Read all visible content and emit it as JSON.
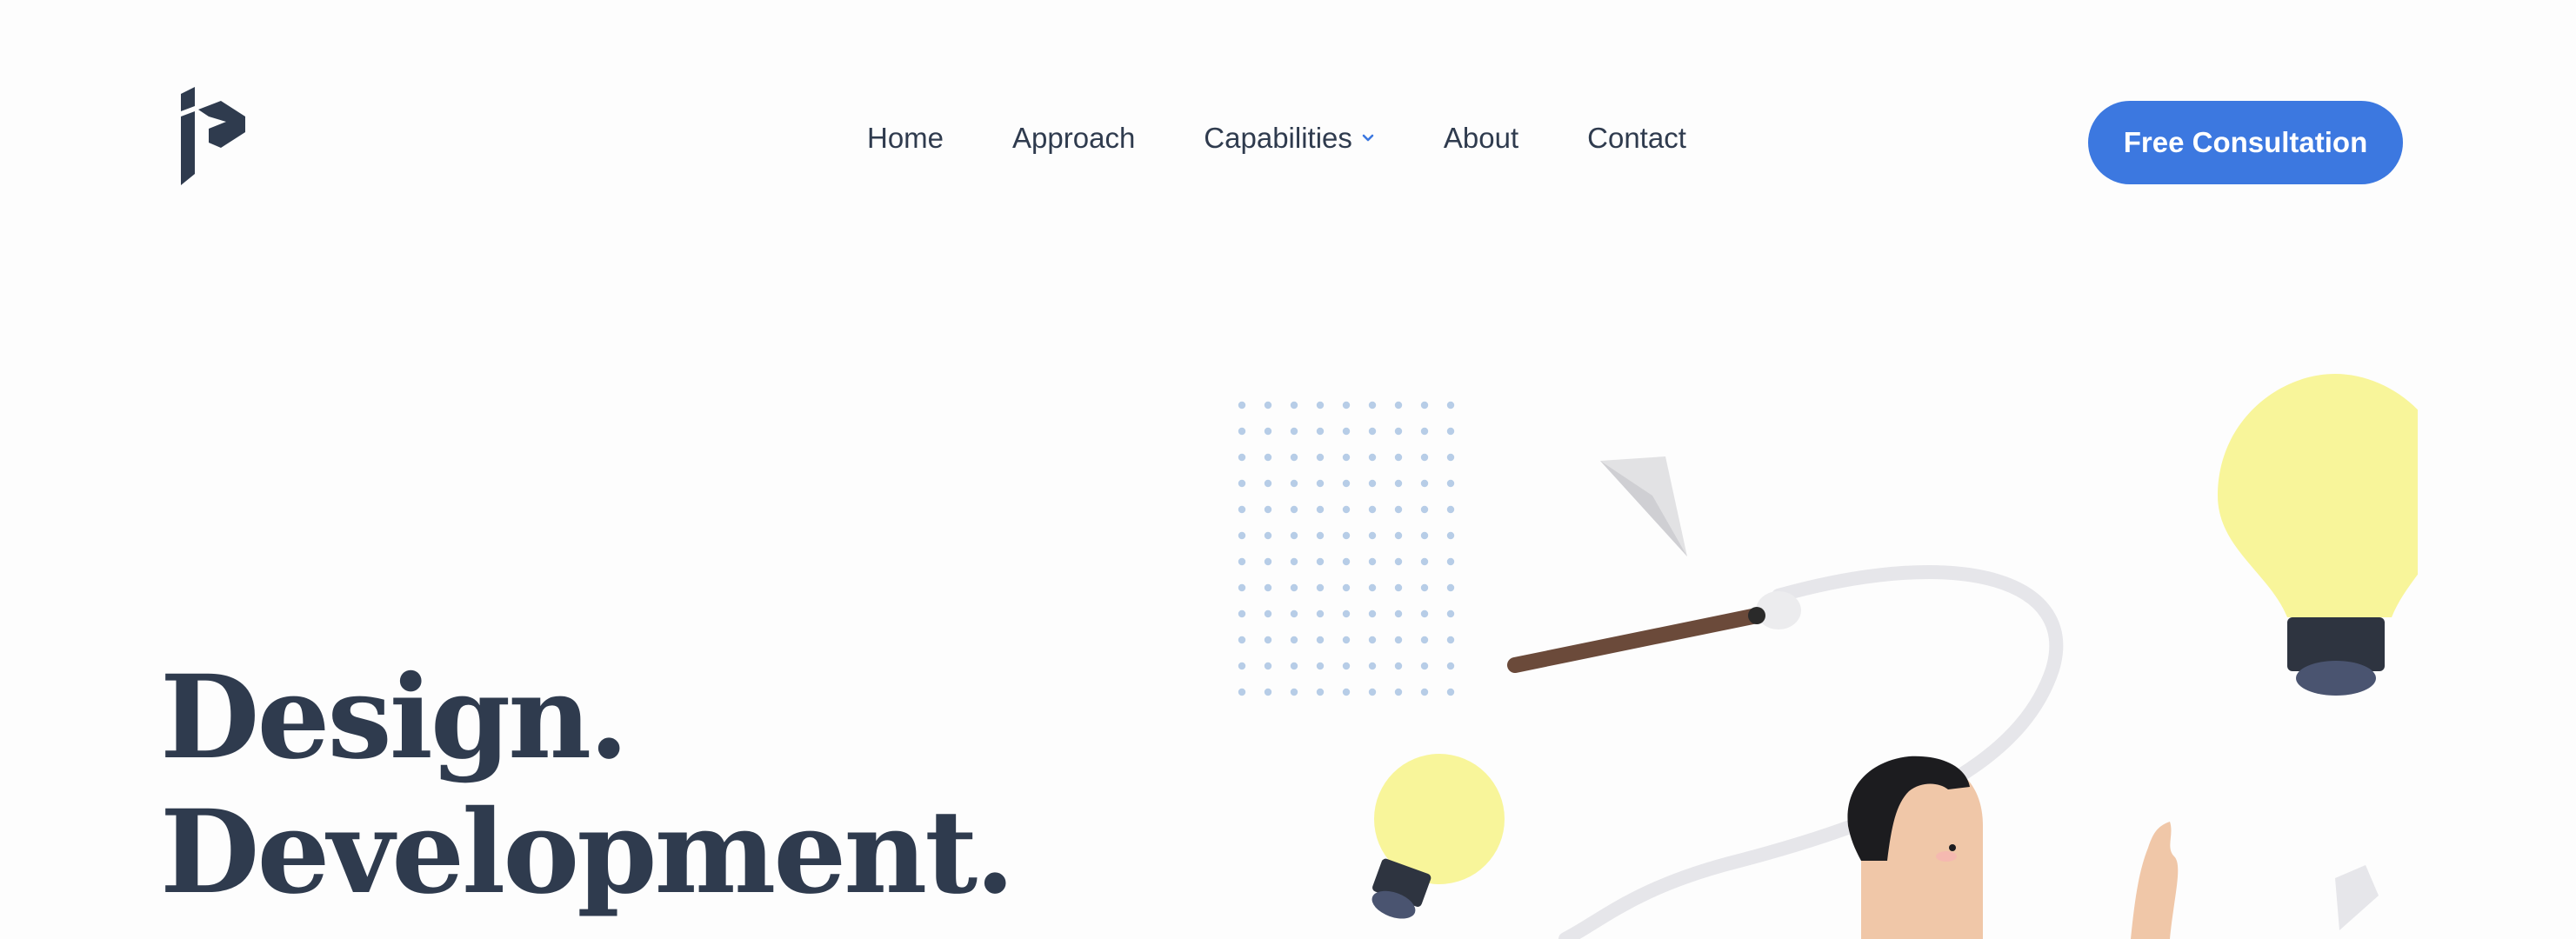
{
  "header": {
    "logo_alt": "P",
    "nav": [
      {
        "label": "Home"
      },
      {
        "label": "Approach"
      },
      {
        "label": "Capabilities",
        "has_dropdown": true
      },
      {
        "label": "About"
      },
      {
        "label": "Contact"
      }
    ],
    "cta_label": "Free Consultation"
  },
  "hero": {
    "line1": "Design.",
    "line2": "Development."
  },
  "colors": {
    "text": "#2f3b4e",
    "accent": "#3c78e0",
    "bulb": "#f8f59a",
    "dots": "#b7cde7"
  },
  "illustration": {
    "icons": [
      "dot-grid",
      "paper-plane-icon",
      "paintbrush-icon",
      "lightbulb-icon",
      "character-avatar"
    ]
  }
}
